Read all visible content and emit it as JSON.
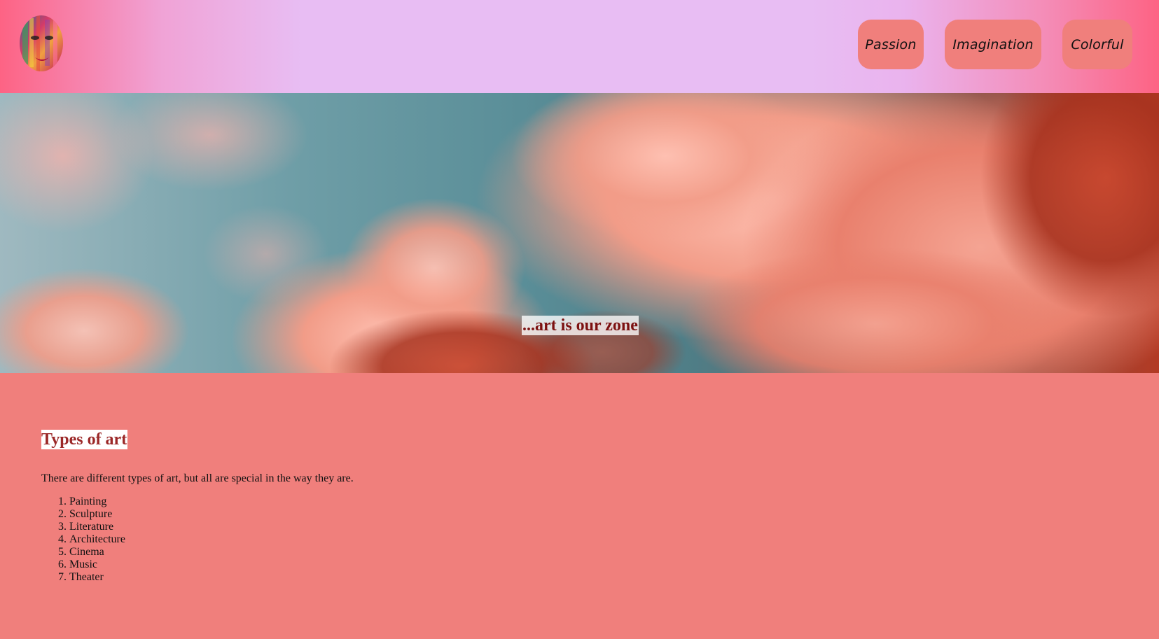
{
  "header": {
    "logo_icon": "painted-face-logo-icon",
    "nav": [
      {
        "label": "Passion"
      },
      {
        "label": "Imagination"
      },
      {
        "label": "Colorful"
      }
    ],
    "gradient_colors": [
      "#fd6384",
      "#e8bdf3"
    ]
  },
  "hero": {
    "tagline": "...art is our zone",
    "background_icon": "pink-clouds-sky-image"
  },
  "main": {
    "title": "Types of art",
    "intro": "There are different types of art, but all are special in the way they are.",
    "items": [
      "Painting",
      "Sculpture",
      "Literature",
      "Architecture",
      "Cinema",
      "Music",
      "Theater"
    ]
  },
  "colors": {
    "page_background": "#f07f7c",
    "button_background": "#f07f7c",
    "title_color": "#9b2828",
    "tagline_color": "#7c1111"
  }
}
